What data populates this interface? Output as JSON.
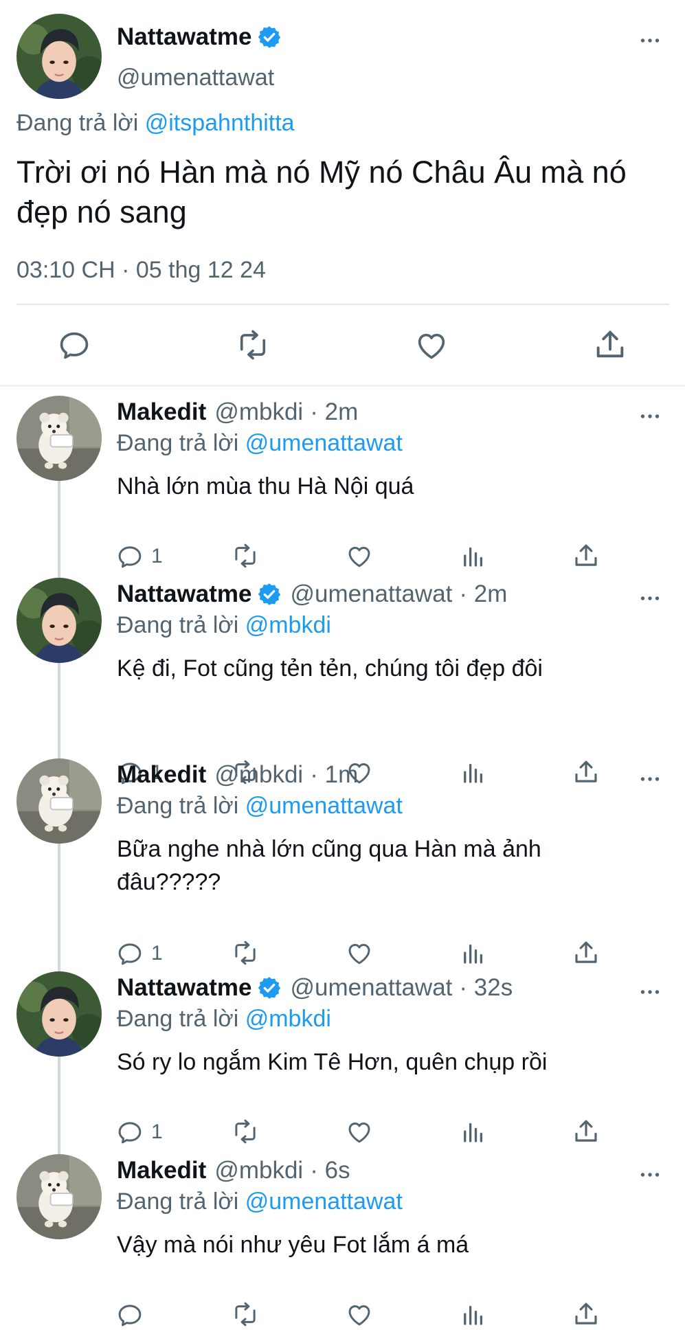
{
  "main_tweet": {
    "display_name": "Nattawatme",
    "handle": "@umenattawat",
    "reply_prefix": "Đang trả lời",
    "reply_to": "@itspahnthitta",
    "text": "Trời ơi nó Hàn mà nó Mỹ nó Châu Âu mà nó đẹp nó sang",
    "timestamp": "03:10 CH · 05 thg 12 24",
    "actions": [
      "reply-icon",
      "retweet-icon",
      "like-icon",
      "share-icon"
    ]
  },
  "replies": [
    {
      "display_name": "Makedit",
      "handle": "@mbkdi",
      "time": "· 2m",
      "verified": false,
      "reply_prefix": "Đang trả lời",
      "reply_to": "@umenattawat",
      "text": "Nhà lớn mùa thu Hà Nội quá",
      "reply_count": "1"
    },
    {
      "display_name": "Nattawatme",
      "handle": "@umenattawat",
      "time": "· 2m",
      "verified": true,
      "reply_prefix": "Đang trả lời",
      "reply_to": "@mbkdi",
      "text": "Kệ đi, Fot cũng tẻn tẻn, chúng tôi đẹp đôi",
      "reply_count": "1"
    },
    {
      "display_name": "Makedit",
      "handle": "@mbkdi",
      "time": "· 1m",
      "verified": false,
      "reply_prefix": "Đang trả lời",
      "reply_to": "@umenattawat",
      "text": "Bữa nghe nhà lớn cũng qua Hàn mà ảnh đâu?????",
      "reply_count": "1"
    },
    {
      "display_name": "Nattawatme",
      "handle": "@umenattawat",
      "time": "· 32s",
      "verified": true,
      "reply_prefix": "Đang trả lời",
      "reply_to": "@mbkdi",
      "text": "Só ry lo ngắm Kim Tê Hơn, quên chụp rồi",
      "reply_count": "1"
    },
    {
      "display_name": "Makedit",
      "handle": "@mbkdi",
      "time": "· 6s",
      "verified": false,
      "reply_prefix": "Đang trả lời",
      "reply_to": "@umenattawat",
      "text": "Vậy mà nói như yêu Fot lắm á má",
      "reply_count": ""
    }
  ],
  "colors": {
    "text_primary": "#0f1419",
    "text_secondary": "#536471",
    "link": "#1d9bf0",
    "verified": "#1d9bf0",
    "divider": "#e6e9ec",
    "thread_line": "#cfd9de"
  }
}
